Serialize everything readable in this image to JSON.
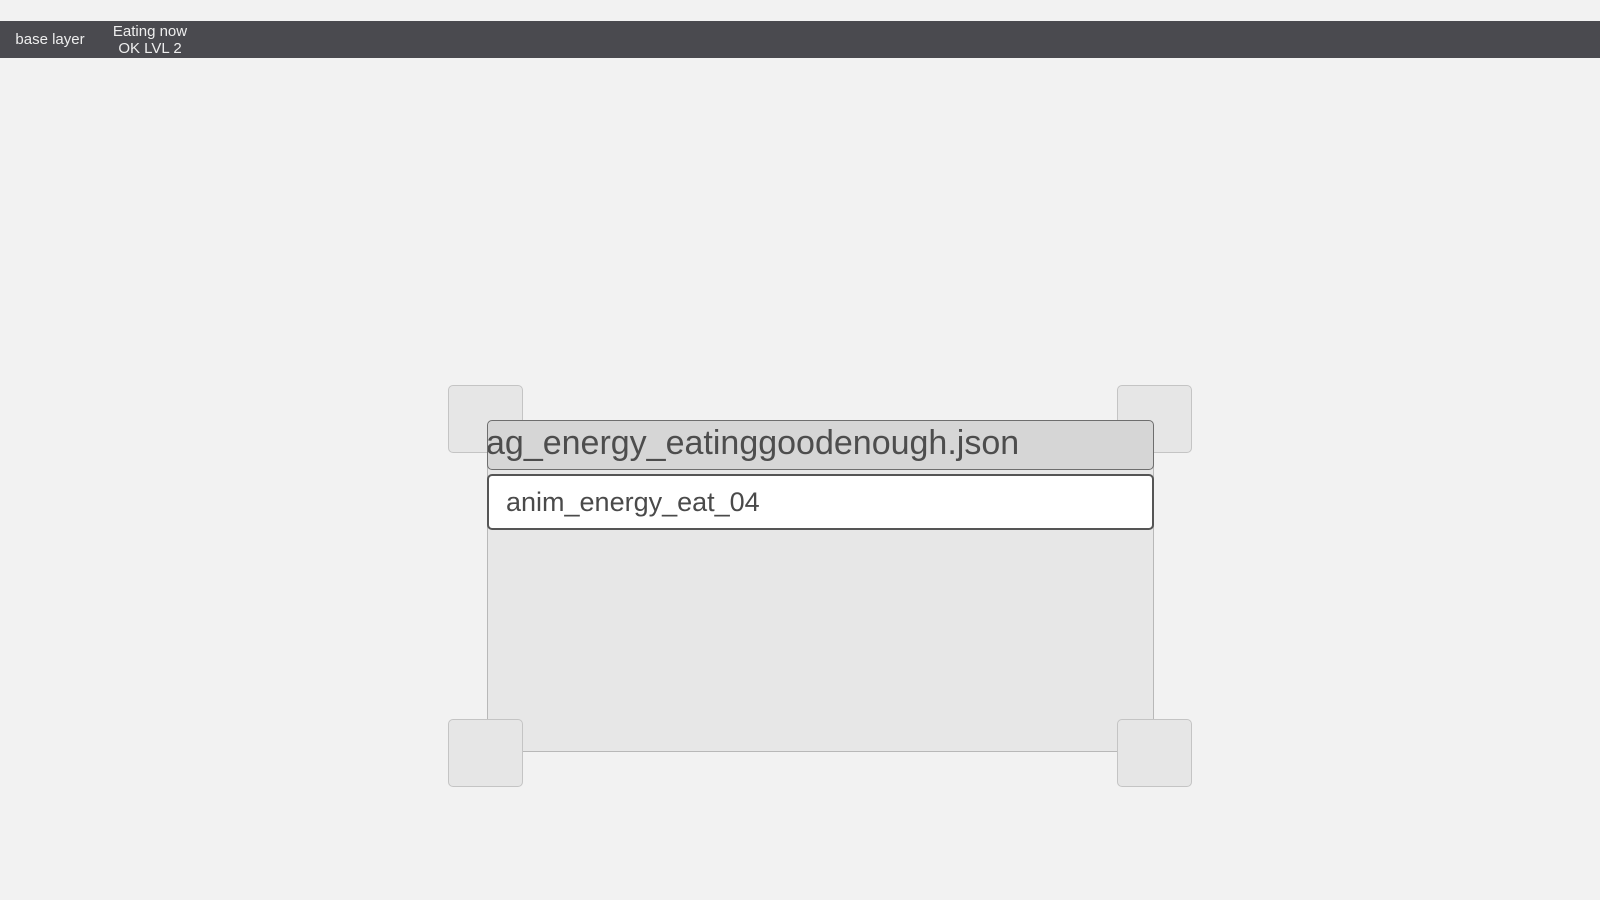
{
  "topbar": {
    "tabs": [
      {
        "label": "base layer"
      },
      {
        "line1": "Eating now",
        "line2": "OK LVL 2"
      }
    ]
  },
  "panel": {
    "title": "ag_energy_eatinggoodenough.json",
    "animation_name": "anim_energy_eat_04"
  }
}
